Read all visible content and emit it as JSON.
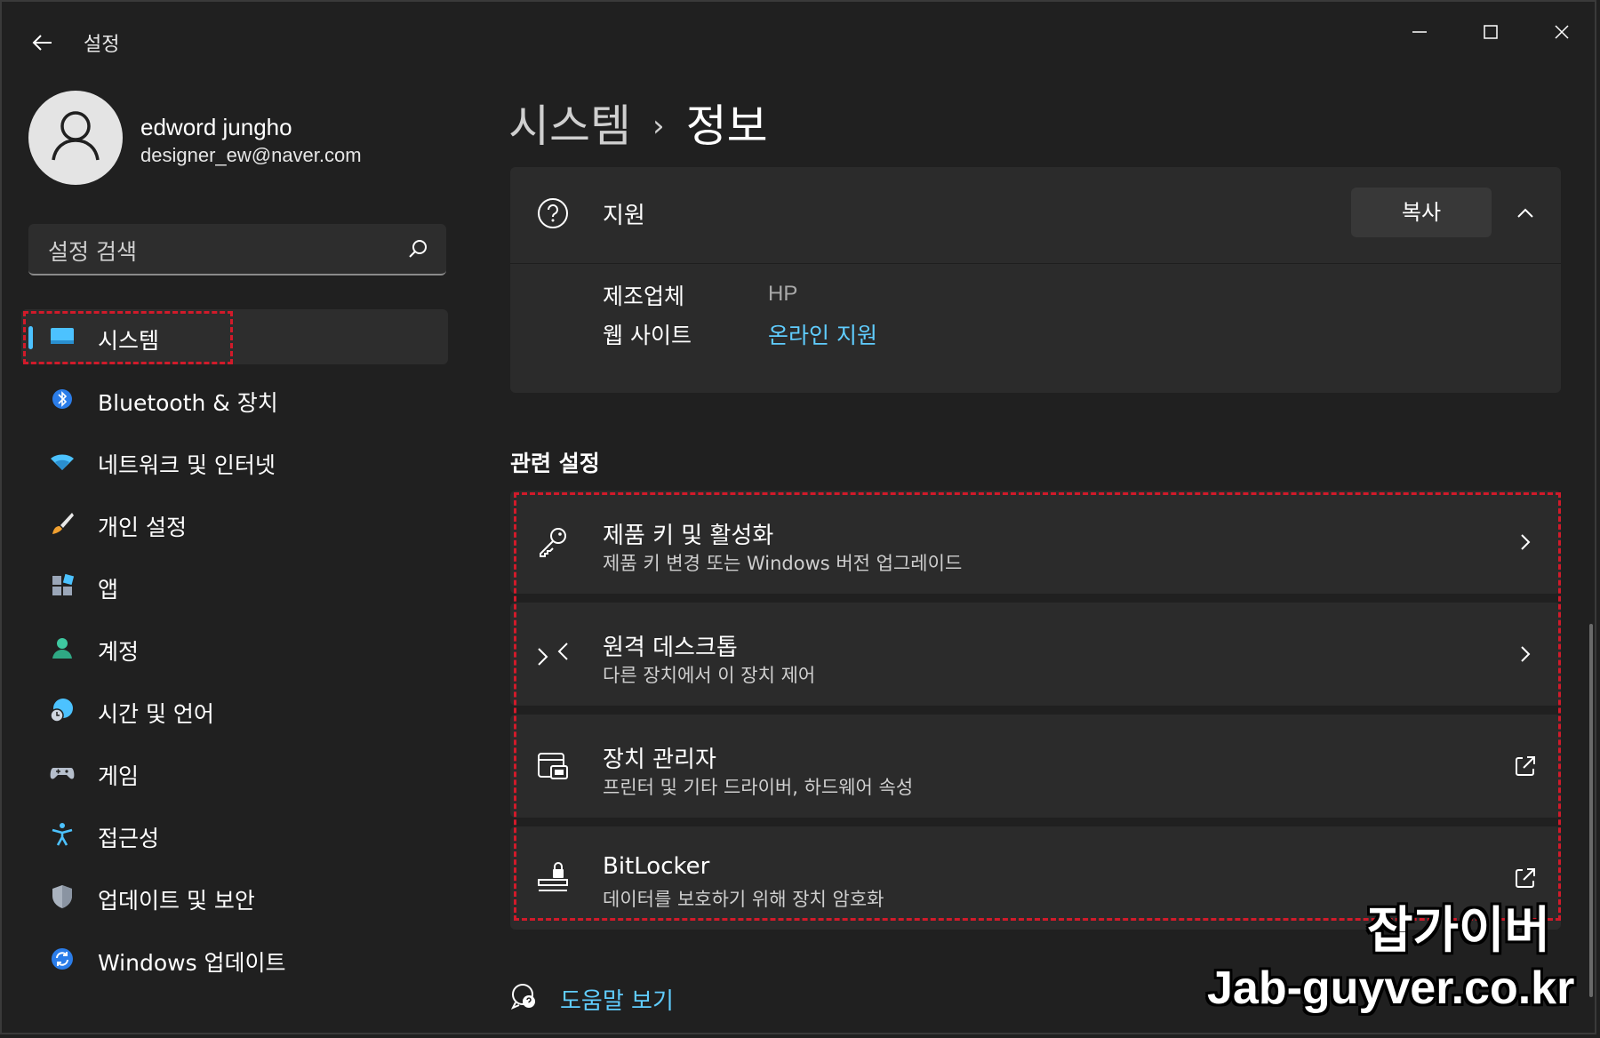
{
  "window": {
    "title": "설정",
    "controls": [
      "minimize-icon",
      "maximize-icon",
      "close-icon"
    ]
  },
  "profile": {
    "name": "edword jungho",
    "email": "designer_ew@naver.com"
  },
  "search": {
    "placeholder": "설정 검색"
  },
  "sidebar": {
    "items": [
      {
        "label": "시스템",
        "icon": "monitor-icon",
        "active": true
      },
      {
        "label": "Bluetooth & 장치",
        "icon": "bluetooth-icon"
      },
      {
        "label": "네트워크 및 인터넷",
        "icon": "wifi-icon"
      },
      {
        "label": "개인 설정",
        "icon": "brush-icon"
      },
      {
        "label": "앱",
        "icon": "apps-icon"
      },
      {
        "label": "계정",
        "icon": "account-icon"
      },
      {
        "label": "시간 및 언어",
        "icon": "globe-clock-icon"
      },
      {
        "label": "게임",
        "icon": "gamepad-icon"
      },
      {
        "label": "접근성",
        "icon": "accessibility-icon"
      },
      {
        "label": "업데이트 및 보안",
        "icon": "shield-icon"
      },
      {
        "label": "Windows 업데이트",
        "icon": "sync-icon"
      }
    ]
  },
  "breadcrumb": {
    "parent": "시스템",
    "separator": "›",
    "current": "정보"
  },
  "support": {
    "title": "지원",
    "copy_label": "복사",
    "manufacturer_label": "제조업체",
    "manufacturer_value": "HP",
    "website_label": "웹 사이트",
    "website_value": "온라인 지원"
  },
  "related": {
    "title": "관련 설정",
    "items": [
      {
        "title": "제품 키 및 활성화",
        "subtitle": "제품 키 변경 또는 Windows 버전 업그레이드",
        "icon": "key-icon",
        "action": "chevron-right-icon"
      },
      {
        "title": "원격 데스크톱",
        "subtitle": "다른 장치에서 이 장치 제어",
        "icon": "remote-desktop-icon",
        "action": "chevron-right-icon"
      },
      {
        "title": "장치 관리자",
        "subtitle": "프린터 및 기타 드라이버, 하드웨어 속성",
        "icon": "device-manager-icon",
        "action": "external-link-icon"
      },
      {
        "title": "BitLocker",
        "subtitle": "데이터를 보호하기 위해 장치 암호화",
        "icon": "bitlocker-icon",
        "action": "external-link-icon"
      }
    ]
  },
  "help": {
    "label": "도움말 보기"
  },
  "watermark": {
    "brand": "잡가이버",
    "url": "Jab-guyver.co.kr"
  },
  "colors": {
    "background": "#202020",
    "card": "#2b2b2b",
    "accent": "#4cc2ff",
    "link": "#60cdff",
    "highlight_box": "#d11a2a"
  }
}
